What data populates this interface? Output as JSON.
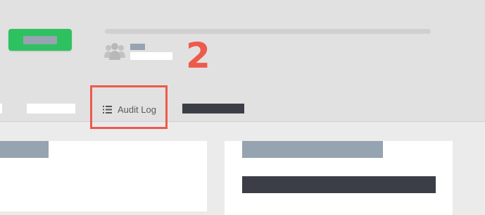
{
  "annotation": {
    "step_number": "2",
    "color": "#ee5a4c"
  },
  "header": {
    "primary_button_color": "#2ec160",
    "progress": null
  },
  "tabs": [
    {
      "label": "",
      "redacted": true
    },
    {
      "label": "",
      "redacted": true
    },
    {
      "label": "Audit Log",
      "icon": "list-icon",
      "highlighted": true
    },
    {
      "label": "",
      "redacted": true
    }
  ],
  "colors": {
    "redaction_gray": "#96a3b0",
    "redaction_dark": "#3b3e46",
    "header_bg": "#e1e1e1",
    "page_bg": "#ebebeb"
  }
}
